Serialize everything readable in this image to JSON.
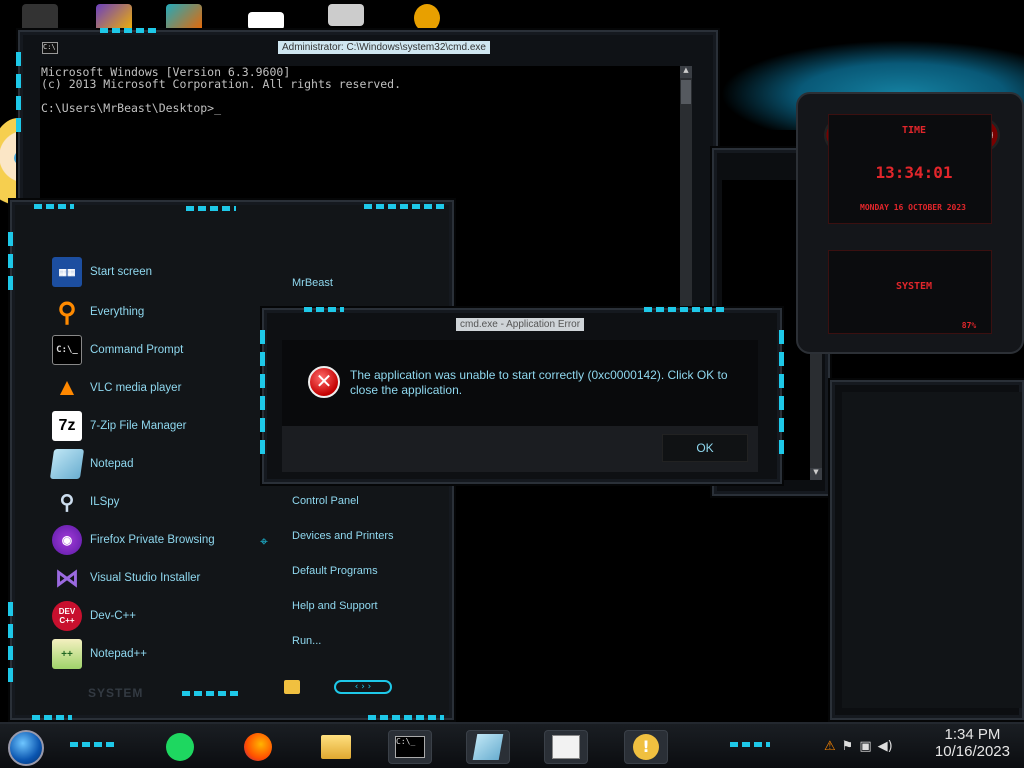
{
  "colors": {
    "accent": "#1ec8e8",
    "menu_text": "#8fd8ef",
    "error_red": "#c40000",
    "gadget_red": "#e2262b"
  },
  "cmd_window": {
    "title": "Administrator: C:\\Windows\\system32\\cmd.exe",
    "lines": [
      "Microsoft Windows [Version 6.3.9600]",
      "(c) 2013 Microsoft Corporation. All rights reserved.",
      "",
      "C:\\Users\\MrBeast\\Desktop>_"
    ]
  },
  "gadget": {
    "time_label": "TIME",
    "time": "13:34:01",
    "date": "MONDAY 16 OCTOBER 2023",
    "system_label": "SYSTEM",
    "cpu_percent": "87%"
  },
  "start_menu": {
    "items": [
      {
        "label": "Start screen",
        "icon": "start-screen-icon"
      },
      {
        "label": "Everything",
        "icon": "everything-search-icon"
      },
      {
        "label": "Command Prompt",
        "icon": "command-prompt-icon"
      },
      {
        "label": "VLC media player",
        "icon": "vlc-cone-icon"
      },
      {
        "label": "7-Zip File Manager",
        "icon": "7zip-icon"
      },
      {
        "label": "Notepad",
        "icon": "notepad-icon"
      },
      {
        "label": "ILSpy",
        "icon": "ilspy-icon"
      },
      {
        "label": "Firefox Private Browsing",
        "icon": "firefox-private-icon"
      },
      {
        "label": "Visual Studio Installer",
        "icon": "visual-studio-installer-icon"
      },
      {
        "label": "Dev-C++",
        "icon": "devcpp-icon"
      },
      {
        "label": "Notepad++",
        "icon": "notepadpp-icon"
      }
    ],
    "user": "MrBeast",
    "right_items": [
      "Control Panel",
      "Devices and Printers",
      "Default Programs",
      "Help and Support",
      "Run..."
    ],
    "system_label": "SYSTEM"
  },
  "error_dialog": {
    "title": "cmd.exe - Application Error",
    "message": "The application was unable to start correctly (0xc0000142). Click OK to close the application.",
    "ok_label": "OK"
  },
  "taskbar": {
    "items": [
      "spotify-icon",
      "firefox-icon",
      "file-explorer-icon",
      "command-prompt-icon",
      "notepad-icon",
      "document-icon",
      "error-message-icon"
    ],
    "time": "1:34 PM",
    "date": "10/16/2023"
  }
}
